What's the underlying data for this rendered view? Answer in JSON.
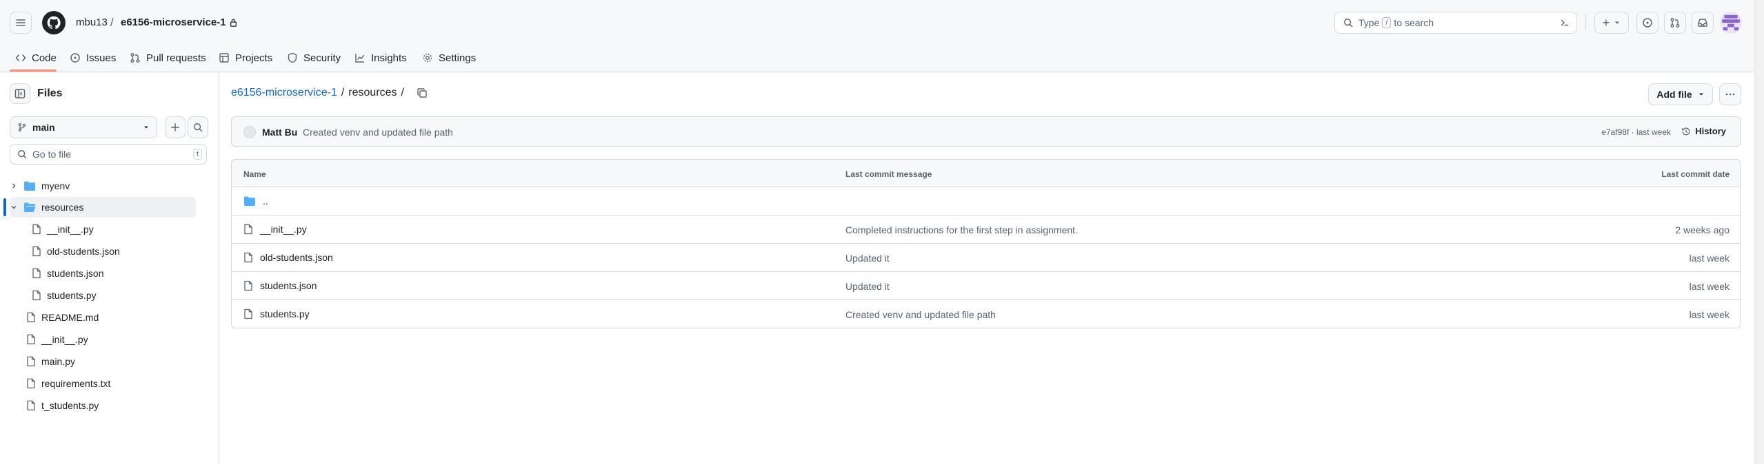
{
  "header": {
    "owner": "mbu13",
    "separator": "/",
    "repo": "e6156-microservice-1",
    "search_prefix": "Type",
    "search_key": "/",
    "search_suffix": "to search",
    "create_plus": "+"
  },
  "tabs": [
    {
      "label": "Code",
      "icon": "code-icon"
    },
    {
      "label": "Issues",
      "icon": "issue-icon"
    },
    {
      "label": "Pull requests",
      "icon": "pull-request-icon"
    },
    {
      "label": "Projects",
      "icon": "table-icon"
    },
    {
      "label": "Security",
      "icon": "shield-icon"
    },
    {
      "label": "Insights",
      "icon": "graph-icon"
    },
    {
      "label": "Settings",
      "icon": "gear-icon"
    }
  ],
  "sidebar": {
    "title": "Files",
    "branch": "main",
    "goto_placeholder": "Go to file",
    "goto_key": "t",
    "tree": [
      {
        "label": "myenv",
        "type": "folder",
        "expanded": false
      },
      {
        "label": "resources",
        "type": "folder",
        "expanded": true,
        "selected": true
      },
      {
        "label": "__init__.py",
        "type": "file"
      },
      {
        "label": "old-students.json",
        "type": "file"
      },
      {
        "label": "students.json",
        "type": "file"
      },
      {
        "label": "students.py",
        "type": "file"
      },
      {
        "label": "README.md",
        "type": "file"
      },
      {
        "label": "__init__.py",
        "type": "file"
      },
      {
        "label": "main.py",
        "type": "file"
      },
      {
        "label": "requirements.txt",
        "type": "file"
      },
      {
        "label": "t_students.py",
        "type": "file"
      }
    ]
  },
  "main": {
    "breadcrumb_repo": "e6156-microservice-1",
    "breadcrumb_sep1": "/",
    "breadcrumb_dir": "resources",
    "breadcrumb_sep2": "/",
    "add_file": "Add file",
    "latest_commit": {
      "author": "Matt Bu",
      "message": "Created venv and updated file path",
      "meta": "e7af98f · last week",
      "history": "History"
    },
    "columns": [
      "Name",
      "Last commit message",
      "Last commit date"
    ],
    "rows": [
      {
        "name": "..",
        "type": "parent",
        "message": "",
        "date": ""
      },
      {
        "name": "__init__.py",
        "type": "file",
        "message": "Completed instructions for the first step in assignment.",
        "date": "2 weeks ago"
      },
      {
        "name": "old-students.json",
        "type": "file",
        "message": "Updated it",
        "date": "last week"
      },
      {
        "name": "students.json",
        "type": "file",
        "message": "Updated it",
        "date": "last week"
      },
      {
        "name": "students.py",
        "type": "file",
        "message": "Created venv and updated file path",
        "date": "last week"
      }
    ]
  },
  "colors": {
    "link": "#0969da",
    "folder": "#54aeff",
    "tab_underline": "#fd8c73",
    "border": "#d1d9e0",
    "muted": "#59636e"
  }
}
